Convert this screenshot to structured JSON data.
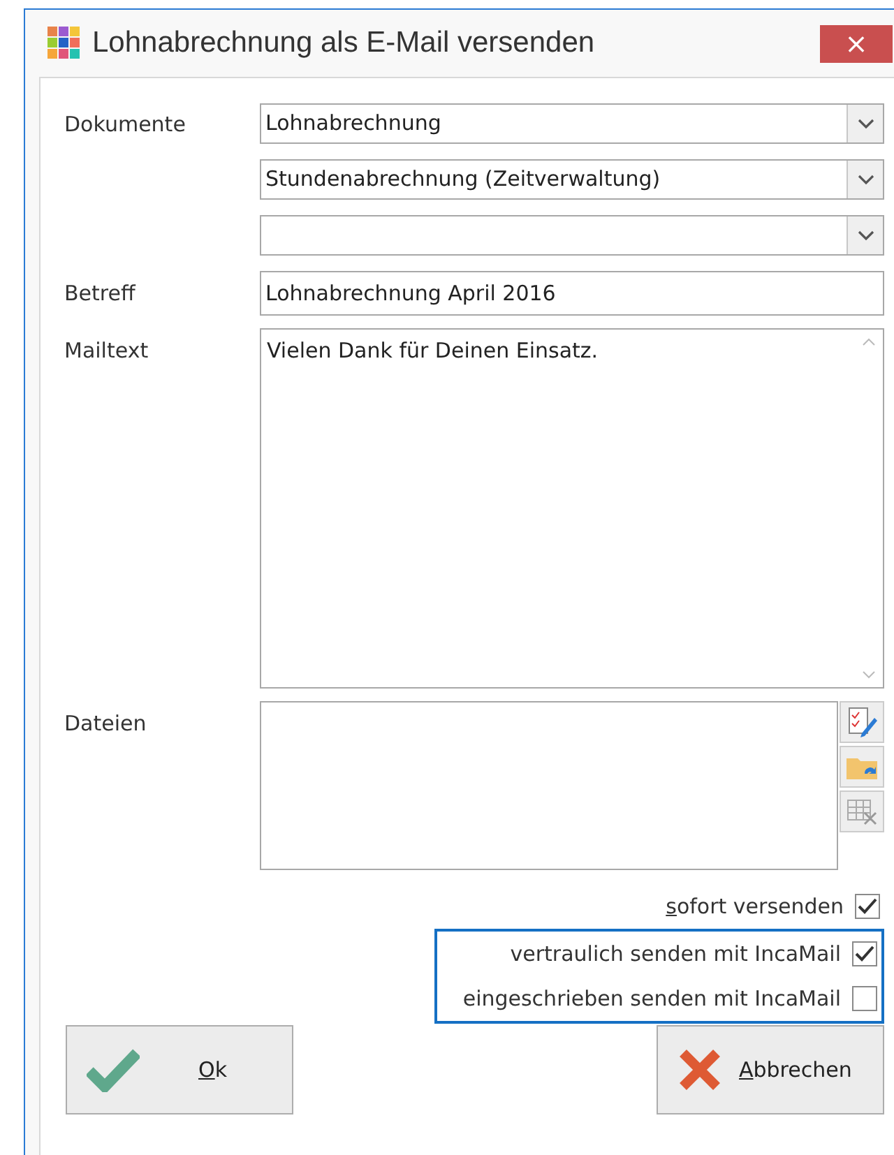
{
  "window": {
    "title": "Lohnabrechnung als E-Mail versenden",
    "close": "×"
  },
  "form": {
    "documents_label": "Dokumente",
    "documents": [
      {
        "value": "Lohnabrechnung"
      },
      {
        "value": "Stundenabrechnung (Zeitverwaltung)"
      }
    ],
    "empty_document_slot": true,
    "subject_label": "Betreff",
    "subject": "Lohnabrechnung April 2016",
    "mailtext_label": "Mailtext",
    "mailtext": "Vielen Dank für Deinen Einsatz.",
    "files_label": "Dateien"
  },
  "options": [
    {
      "label": "sofort versenden",
      "checked": true,
      "underline_first": true
    }
  ],
  "incamail_options": [
    {
      "label": "vertraulich senden mit IncaMail",
      "checked": true
    },
    {
      "label": "eingeschrieben senden mit IncaMail",
      "checked": false
    }
  ],
  "buttons": [
    {
      "label": "Ok",
      "kind": "ok"
    },
    {
      "label": "Abbrechen",
      "kind": "cancel"
    }
  ]
}
